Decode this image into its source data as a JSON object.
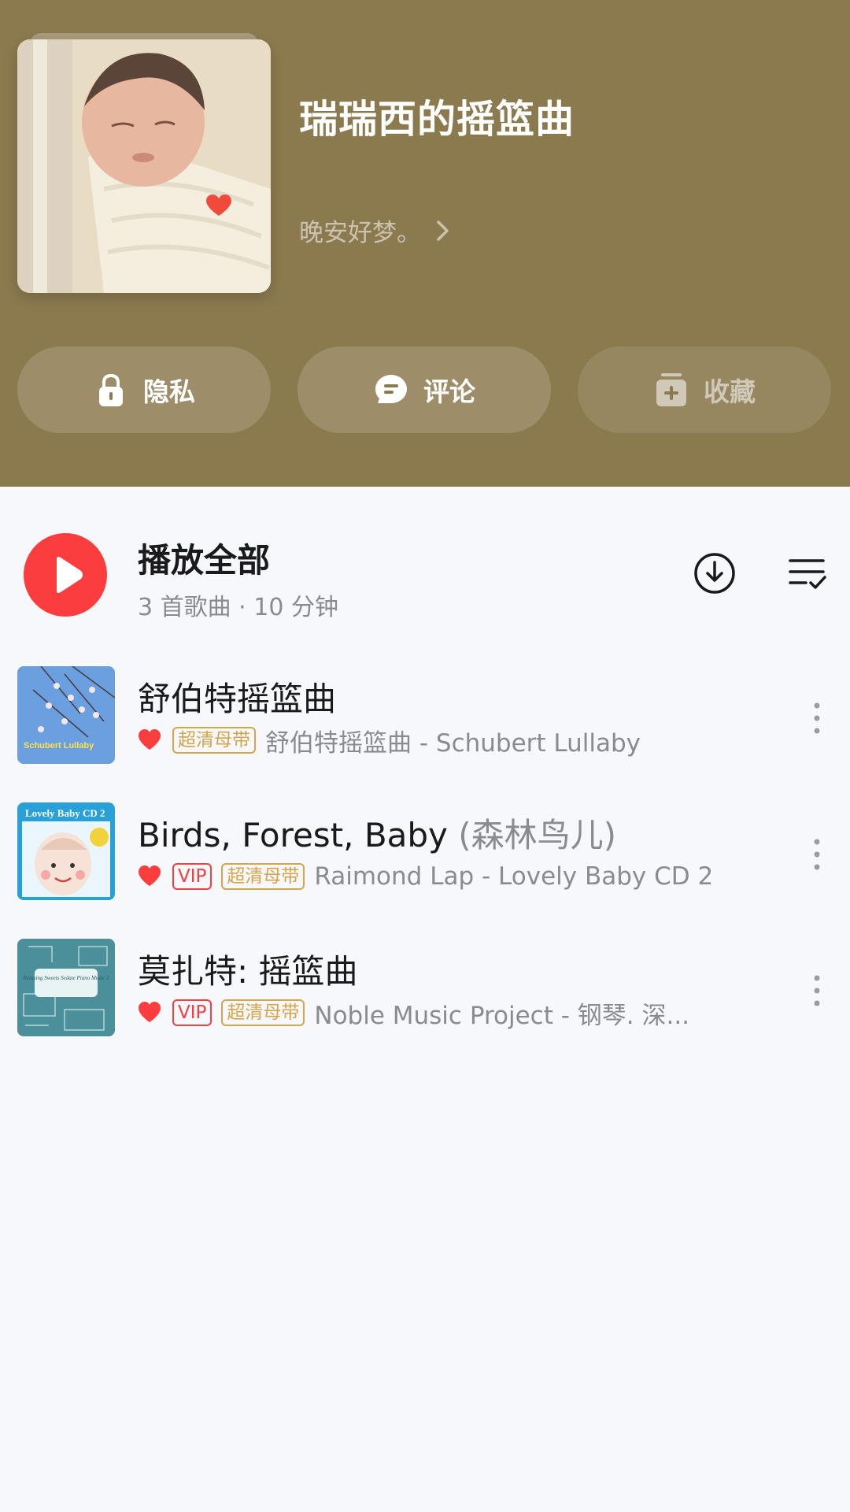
{
  "playlist": {
    "title": "瑞瑞西的摇篮曲",
    "description": "晚安好梦。",
    "header_color": "#8c7a4f"
  },
  "actions": [
    {
      "label": "隐私",
      "icon": "lock-icon"
    },
    {
      "label": "评论",
      "icon": "comment-icon"
    },
    {
      "label": "收藏",
      "icon": "add-collection-icon"
    }
  ],
  "play_all": {
    "title": "播放全部",
    "subtitle": "3 首歌曲 · 10 分钟",
    "accent": "#fc3d3d"
  },
  "songs": [
    {
      "title": "舒伯特摇篮曲",
      "title_suffix": "",
      "liked": true,
      "tags": [
        "超清母带"
      ],
      "meta": "舒伯特摇篮曲 - Schubert Lullaby",
      "cover_text": "Schubert Lullaby"
    },
    {
      "title": "Birds, Forest, Baby",
      "title_suffix": "(森林鸟儿)",
      "liked": true,
      "tags": [
        "VIP",
        "超清母带"
      ],
      "meta": "Raimond Lap - Lovely Baby CD 2",
      "cover_text": "Lovely Baby CD 2"
    },
    {
      "title": "莫扎特: 摇篮曲",
      "title_suffix": "",
      "liked": true,
      "tags": [
        "VIP",
        "超清母带"
      ],
      "meta": "Noble Music Project - 钢琴. 深...",
      "cover_text": "Relaxing Sweets Sedate Piano Music 2"
    }
  ]
}
